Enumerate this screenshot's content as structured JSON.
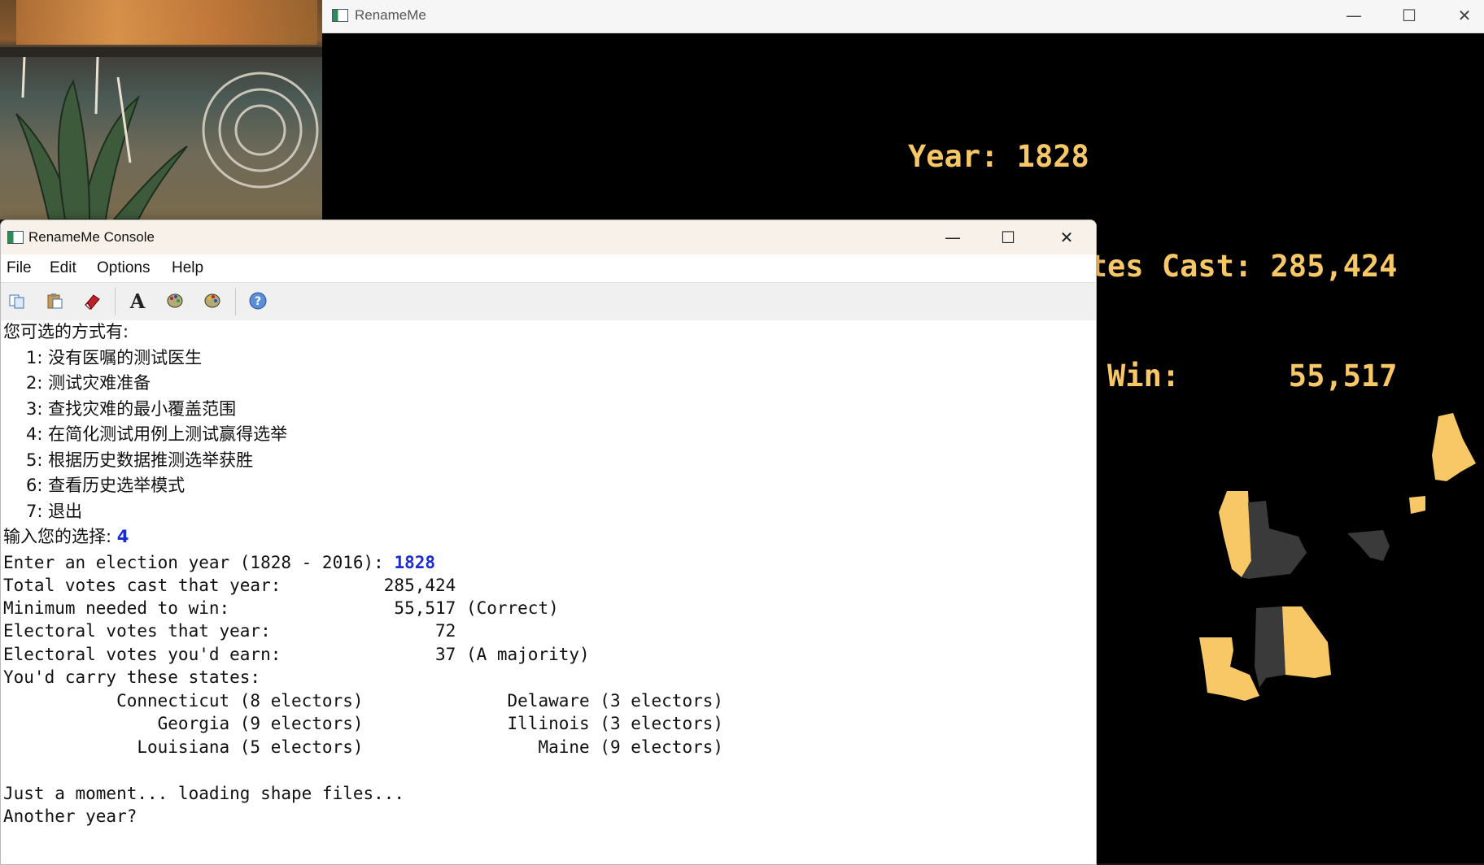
{
  "gfx_window": {
    "title": "RenameMe",
    "stats": {
      "year_label": "Year:",
      "year_value": "1828",
      "votes_label": "Popular Votes Cast:",
      "votes_value": "285,424",
      "min_label": "Minimum to Win:",
      "min_value": "55,517"
    },
    "map": {
      "highlight_color": "#f8c766",
      "other_color": "#3a3a3a"
    }
  },
  "console_window": {
    "title": "RenameMe Console",
    "menu": [
      "File",
      "Edit",
      "Options",
      "Help"
    ],
    "toolbar_icons": [
      "copy-icon",
      "paste-icon",
      "eraser-icon",
      "font-icon",
      "palette-icon",
      "palette-alt-icon",
      "help-icon"
    ],
    "output": {
      "prompt_header": "您可选的方式有:",
      "options": [
        "1: 没有医嘱的测试医生",
        "2: 测试灾难准备",
        "3: 查找灾难的最小覆盖范围",
        "4: 在简化测试用例上测试赢得选举",
        "5: 根据历史数据推测选举获胜",
        "6: 查看历史选举模式",
        "7: 退出"
      ],
      "choice_prompt": "输入您的选择:",
      "choice_value": "4",
      "year_prompt": "Enter an election year (1828 - 2016):",
      "year_value": "1828",
      "total_line": "Total votes cast that year:          285,424",
      "min_line": "Minimum needed to win:                55,517 (Correct)",
      "ev_line": "Electoral votes that year:                72",
      "earn_line": "Electoral votes you'd earn:               37 (A majority)",
      "carry_line": "You'd carry these states:",
      "states_rows": [
        "           Connecticut (8 electors)              Delaware (3 electors)",
        "               Georgia (9 electors)              Illinois (3 electors)",
        "             Louisiana (5 electors)                 Maine (9 electors)"
      ],
      "loading_line": "Just a moment... loading shape files...",
      "another_line": "Another year?"
    }
  }
}
